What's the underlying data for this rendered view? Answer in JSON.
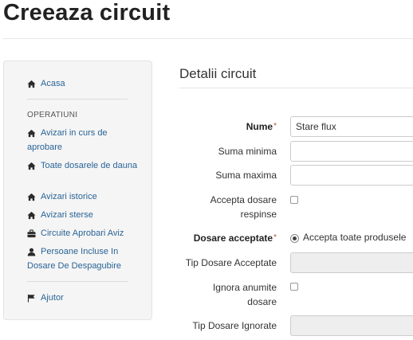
{
  "page": {
    "title": "Creeaza circuit"
  },
  "sidebar": {
    "home": {
      "label": "Acasa",
      "icon": "home-icon"
    },
    "section_header": "OPERATIUNI",
    "items": [
      {
        "label": "Avizari in curs de aprobare",
        "icon": "home-icon"
      },
      {
        "label": "Toate dosarele de dauna",
        "icon": "home-icon"
      },
      {
        "label": "Avizari istorice",
        "icon": "home-icon"
      },
      {
        "label": "Avizari sterse",
        "icon": "home-icon"
      },
      {
        "label": "Circuite Aprobari Aviz",
        "icon": "briefcase-icon"
      },
      {
        "label": "Persoane Incluse In Dosare De Despagubire",
        "icon": "user-icon"
      }
    ],
    "help": {
      "label": "Ajutor",
      "icon": "flag-icon"
    }
  },
  "form": {
    "section_title": "Detalii circuit",
    "nume": {
      "label": "Nume",
      "required_mark": "*",
      "value": "Stare flux"
    },
    "suma_minima": {
      "label": "Suma minima",
      "value": ""
    },
    "suma_maxima": {
      "label": "Suma maxima",
      "value": ""
    },
    "accepta_dosare_respinse": {
      "label": "Accepta dosare respinse",
      "checked": false
    },
    "dosare_acceptate": {
      "label": "Dosare acceptate",
      "required_mark": "*",
      "option": "Accepta toate produsele",
      "selected": true
    },
    "tip_dosare_acceptate": {
      "label": "Tip Dosare Acceptate",
      "value": ""
    },
    "ignora_anumite_dosare": {
      "label": "Ignora anumite dosare",
      "checked": false
    },
    "tip_dosare_ignorate": {
      "label": "Tip Dosare Ignorate",
      "value": ""
    }
  },
  "colors": {
    "link": "#2a6496",
    "required": "#b94a48",
    "sidebar_bg": "#f5f5f5"
  }
}
